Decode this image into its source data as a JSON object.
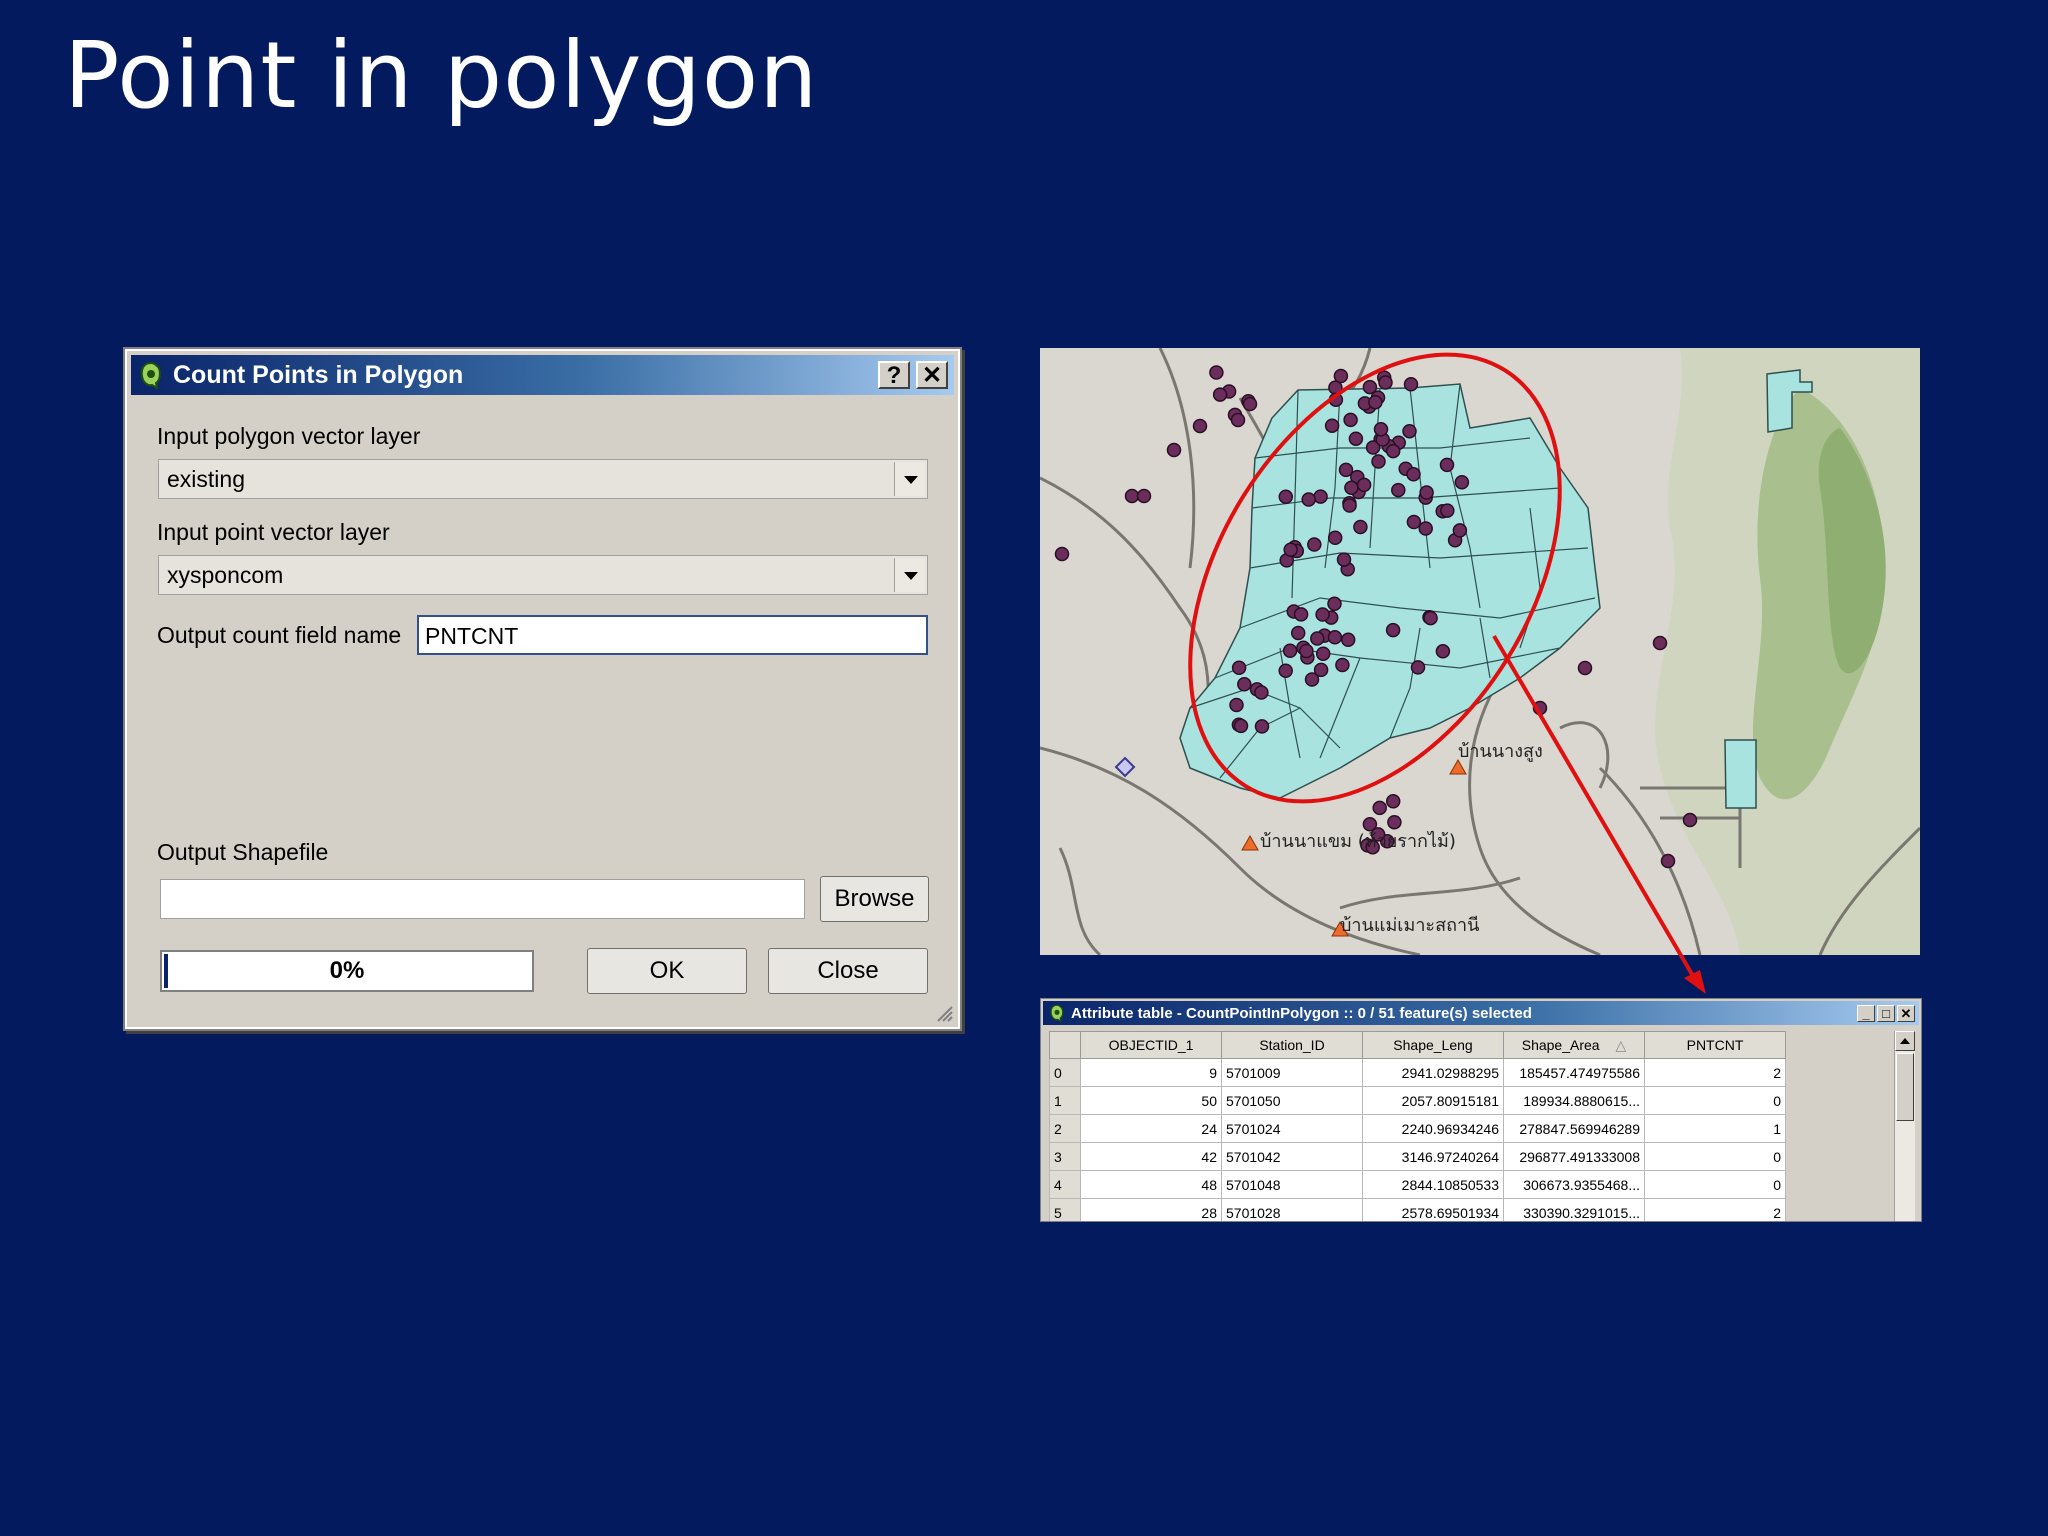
{
  "slide": {
    "title": "Point in polygon"
  },
  "dialog": {
    "title": "Count Points in Polygon",
    "help_label": "?",
    "close_x_label": "✕",
    "polygon_layer_label": "Input polygon vector layer",
    "polygon_layer_value": "existing",
    "point_layer_label": "Input point vector layer",
    "point_layer_value": "xysponcom",
    "count_field_label": "Output count field name",
    "count_field_value": "PNTCNT",
    "output_shapefile_label": "Output Shapefile",
    "output_shapefile_value": "",
    "browse_label": "Browse",
    "progress_text": "0%",
    "progress": 0,
    "ok_label": "OK",
    "close_label": "Close"
  },
  "map": {
    "labels": [
      "บ้านนางสูง",
      "บ้านนาแขม (ห้วยรากไม้)",
      "บ้านแม่เมาะสถานี"
    ],
    "colors": {
      "polygon_fill": "#a9e3e0",
      "polygon_stroke": "#2f4f4f",
      "point_fill": "#6b2d5c",
      "ellipse": "#e01010",
      "base": "#d9d7cf"
    }
  },
  "attribute_table": {
    "title": "Attribute table - CountPointInPolygon :: 0 / 51 feature(s) selected",
    "window_buttons": [
      "_",
      "□",
      "✕"
    ],
    "columns": [
      "OBJECTID_1",
      "Station_ID",
      "Shape_Leng",
      "Shape_Area",
      "PNTCNT"
    ],
    "sort_indicator": "△",
    "rows": [
      {
        "index": "0",
        "cells": [
          "9",
          "5701009",
          "2941.02988295",
          "185457.474975586",
          "2"
        ]
      },
      {
        "index": "1",
        "cells": [
          "50",
          "5701050",
          "2057.80915181",
          "189934.8880615...",
          "0"
        ]
      },
      {
        "index": "2",
        "cells": [
          "24",
          "5701024",
          "2240.96934246",
          "278847.569946289",
          "1"
        ]
      },
      {
        "index": "3",
        "cells": [
          "42",
          "5701042",
          "3146.97240264",
          "296877.491333008",
          "0"
        ]
      },
      {
        "index": "4",
        "cells": [
          "48",
          "5701048",
          "2844.10850533",
          "306673.9355468...",
          "0"
        ]
      },
      {
        "index": "5",
        "cells": [
          "28",
          "5701028",
          "2578.69501934",
          "330390.3291015...",
          "2"
        ]
      }
    ]
  }
}
